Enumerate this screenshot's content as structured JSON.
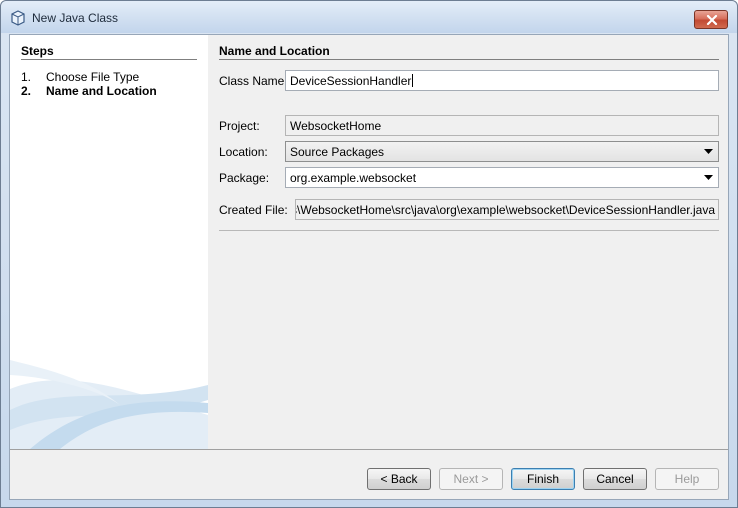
{
  "window": {
    "title": "New Java Class"
  },
  "steps": {
    "title": "Steps",
    "items": [
      {
        "num": "1.",
        "label": "Choose File Type"
      },
      {
        "num": "2.",
        "label": "Name and Location"
      }
    ]
  },
  "panel": {
    "title": "Name and Location",
    "class_name": {
      "label": "Class Name:",
      "value": "DeviceSessionHandler"
    },
    "project": {
      "label": "Project:",
      "value": "WebsocketHome"
    },
    "location": {
      "label": "Location:",
      "value": "Source Packages"
    },
    "package": {
      "label": "Package:",
      "value": "org.example.websocket"
    },
    "created_file": {
      "label": "Created File:",
      "value": ":\\Projects\\WebsocketHome\\src\\java\\org\\example\\websocket\\DeviceSessionHandler.java"
    }
  },
  "buttons": {
    "back": "< Back",
    "next": "Next >",
    "finish": "Finish",
    "cancel": "Cancel",
    "help": "Help"
  },
  "colors": {
    "accent": "#3c7fb1",
    "close": "#c24a33"
  },
  "icons": {
    "app": "java-class-icon",
    "close": "close-icon",
    "dropdown": "chevron-down-icon"
  }
}
